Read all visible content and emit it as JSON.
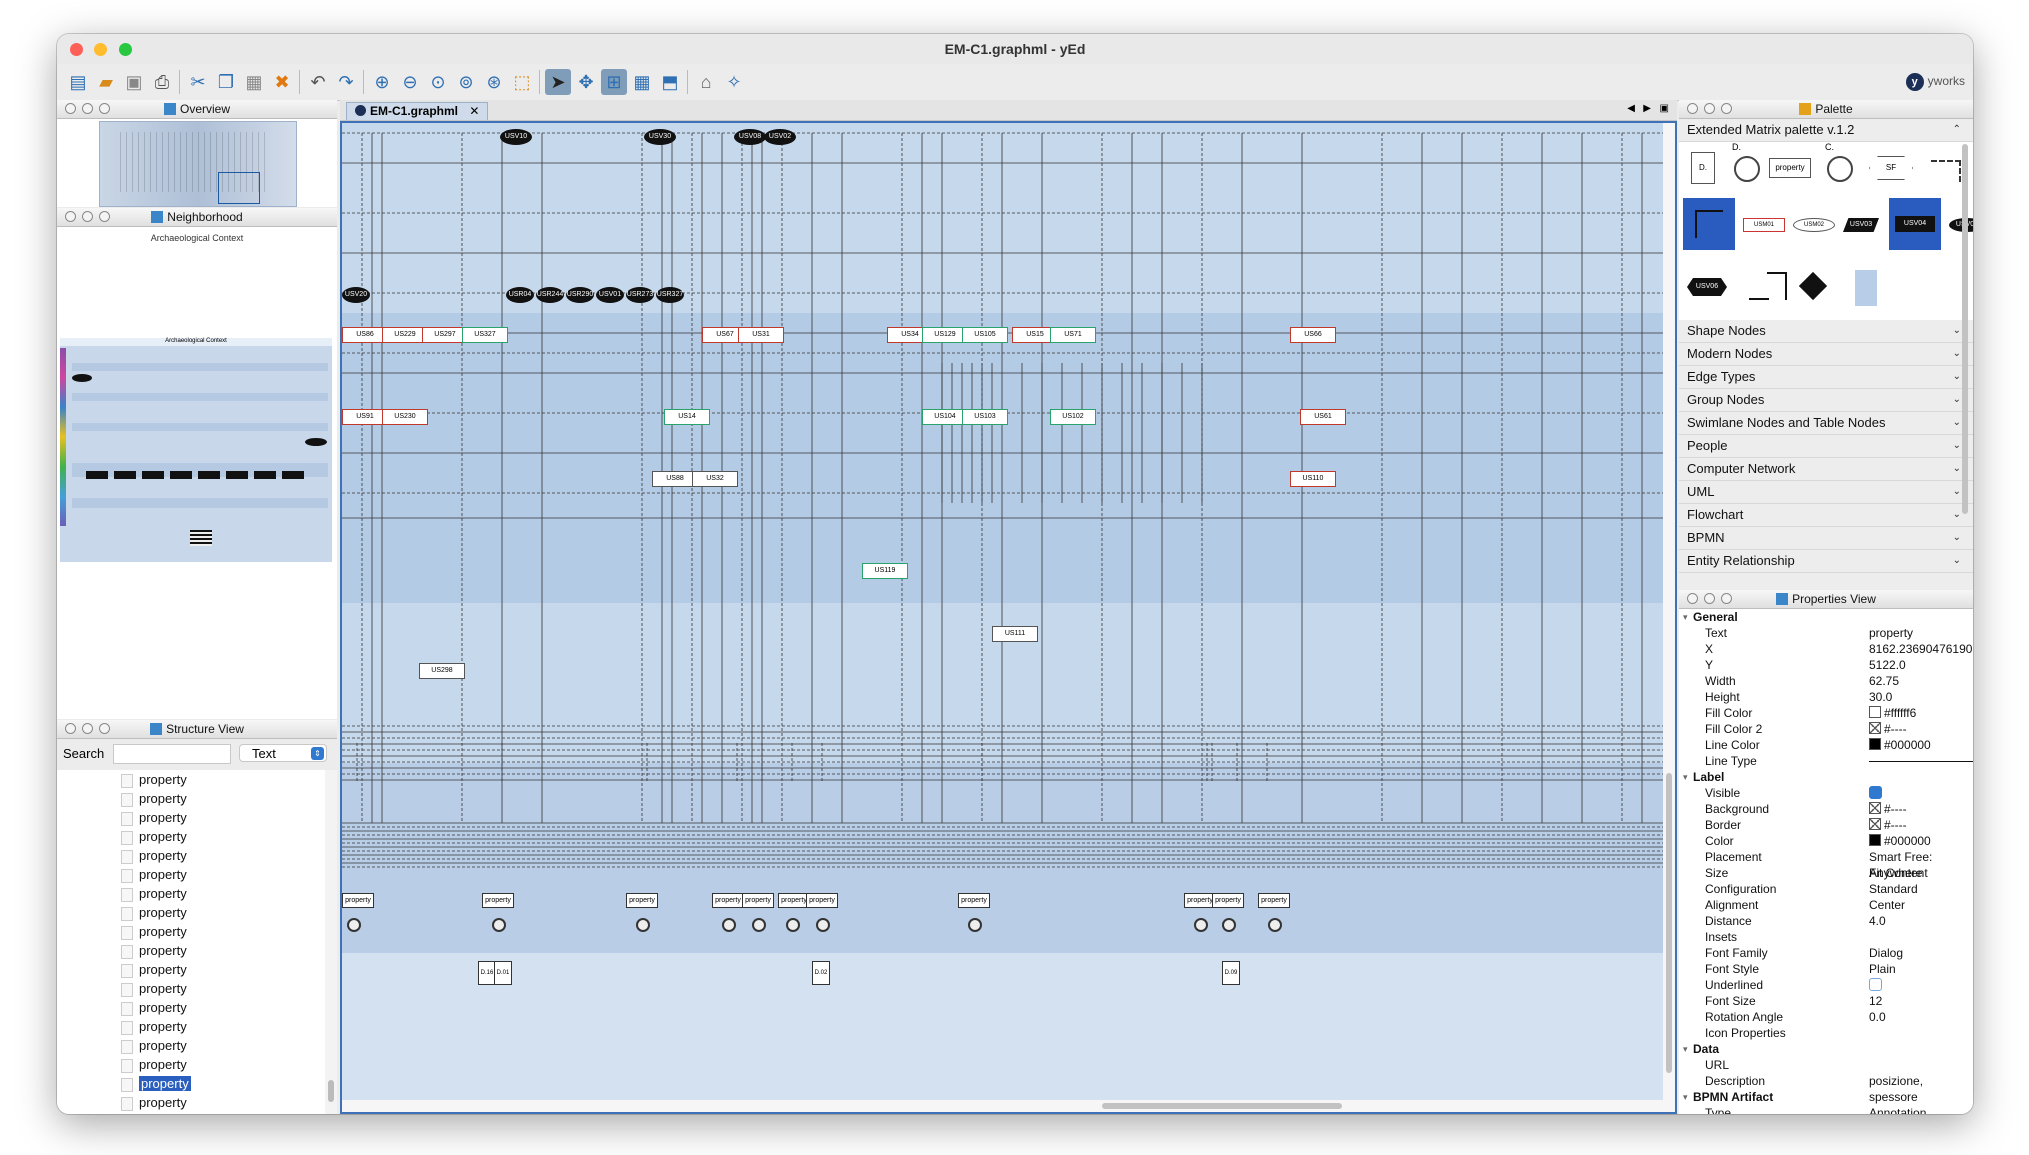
{
  "window": {
    "title": "EM-C1.graphml - yEd"
  },
  "toolbar": {
    "brand": "yworks"
  },
  "overview": {
    "title": "Overview"
  },
  "neighborhood": {
    "title": "Neighborhood",
    "context_label": "Archaeological Context",
    "context_label2": "Archaeological Context"
  },
  "structure": {
    "title": "Structure View",
    "search_label": "Search",
    "search_value": "",
    "mode": "Text",
    "items": [
      "property",
      "property",
      "property",
      "property",
      "property",
      "property",
      "property",
      "property",
      "property",
      "property",
      "property",
      "property",
      "property",
      "property",
      "property",
      "property",
      "property",
      "property",
      "property",
      "property"
    ],
    "selected_index": 16
  },
  "document": {
    "tab": "EM-C1.graphml",
    "black_nodes_top": [
      "USV10",
      "USV30",
      "USV08",
      "USV02"
    ],
    "black_nodes_row": [
      "USV20",
      "USR04",
      "USR244",
      "USR290",
      "USV01",
      "USR273",
      "USR327"
    ],
    "red_nodes": [
      "US86",
      "US229",
      "US297",
      "US91",
      "US230",
      "US67",
      "US31",
      "US34",
      "US15",
      "US66",
      "US61",
      "US110"
    ],
    "green_nodes": [
      "US327",
      "US14",
      "US129",
      "US105",
      "US71",
      "US104",
      "US103",
      "US102",
      "US119"
    ],
    "plain_nodes": [
      "US88",
      "US32",
      "US111",
      "US298"
    ],
    "property_label": "property",
    "doc_nodes": [
      "D.16",
      "D.01",
      "D.02",
      "D.09"
    ]
  },
  "palette": {
    "title": "Palette",
    "extended": "Extended Matrix palette v.1.2",
    "icons": {
      "d_label": "D.",
      "c_label": "C.",
      "property": "property",
      "sf": "SF",
      "usm01": "USM01",
      "usm02": "USM02",
      "usv03": "USV03",
      "usv04": "USV04",
      "usv05": "USV05",
      "usv06": "USV06"
    },
    "sections": [
      "Shape Nodes",
      "Modern Nodes",
      "Edge Types",
      "Group Nodes",
      "Swimlane Nodes and Table Nodes",
      "People",
      "Computer Network",
      "UML",
      "Flowchart",
      "BPMN",
      "Entity Relationship"
    ]
  },
  "properties": {
    "title": "Properties View",
    "rows": [
      {
        "group": "General"
      },
      {
        "k": "Text",
        "v": "property"
      },
      {
        "k": "X",
        "v": "8162.236904761905"
      },
      {
        "k": "Y",
        "v": "5122.0"
      },
      {
        "k": "Width",
        "v": "62.75"
      },
      {
        "k": "Height",
        "v": "30.0"
      },
      {
        "k": "Fill Color",
        "v": "#ffffff6",
        "sw": "#ffffff"
      },
      {
        "k": "Fill Color 2",
        "v": "#----",
        "sw": "x"
      },
      {
        "k": "Line Color",
        "v": "#000000",
        "sw": "#000000"
      },
      {
        "k": "Line Type",
        "v": "",
        "line": true
      },
      {
        "group": "Label"
      },
      {
        "k": "Visible",
        "v": "",
        "chk": true
      },
      {
        "k": "Background",
        "v": "#----",
        "sw": "x"
      },
      {
        "k": "Border",
        "v": "#----",
        "sw": "x"
      },
      {
        "k": "Color",
        "v": "#000000",
        "sw": "#000000"
      },
      {
        "k": "Placement",
        "v": "Smart Free: Anywhere"
      },
      {
        "k": "Size",
        "v": "Fit Content"
      },
      {
        "k": "Configuration",
        "v": "Standard"
      },
      {
        "k": "Alignment",
        "v": "Center"
      },
      {
        "k": "Distance",
        "v": "4.0"
      },
      {
        "k": "Insets",
        "v": ""
      },
      {
        "k": "Font Family",
        "v": "Dialog"
      },
      {
        "k": "Font Style",
        "v": "Plain"
      },
      {
        "k": "Underlined",
        "v": "",
        "chk": false
      },
      {
        "k": "Font Size",
        "v": "12"
      },
      {
        "k": "Rotation Angle",
        "v": "0.0"
      },
      {
        "k": "Icon Properties",
        "v": ""
      },
      {
        "group": "Data"
      },
      {
        "k": "URL",
        "v": ""
      },
      {
        "k": "Description",
        "v": "posizione, spessore"
      },
      {
        "group": "BPMN Artifact"
      },
      {
        "k": "Type",
        "v": "Annotation"
      },
      {
        "k": "Shadow",
        "v": "",
        "chk": true
      }
    ]
  }
}
